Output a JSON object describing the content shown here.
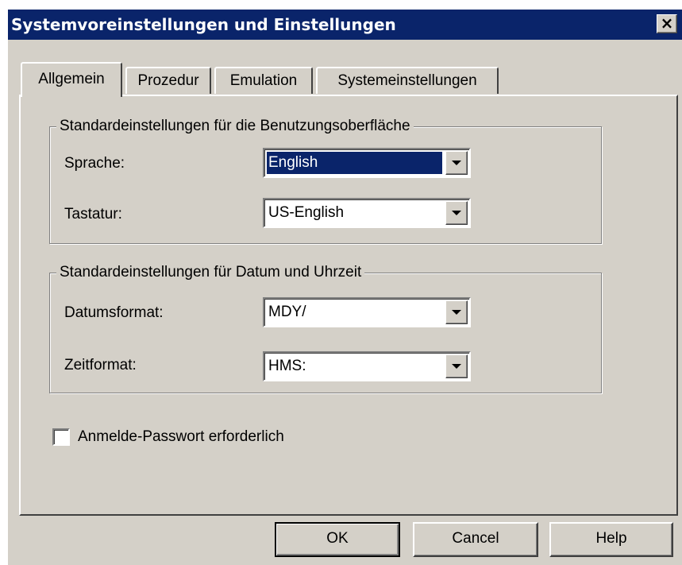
{
  "window": {
    "title": "Systemvoreinstellungen und Einstellungen",
    "close_label": "×"
  },
  "tabs": [
    {
      "label": "Allgemein",
      "active": true
    },
    {
      "label": "Prozedur",
      "active": false
    },
    {
      "label": "Emulation",
      "active": false
    },
    {
      "label": "Systemeinstellungen",
      "active": false
    }
  ],
  "group_ui": {
    "legend": "Standardeinstellungen für die Benutzungsoberfläche",
    "language_label": "Sprache:",
    "language_value": "English",
    "keyboard_label": "Tastatur:",
    "keyboard_value": "US-English"
  },
  "group_datetime": {
    "legend": "Standardeinstellungen für Datum und Uhrzeit",
    "date_label": "Datumsformat:",
    "date_value": "MDY/",
    "time_label": "Zeitformat:",
    "time_value": "HMS:"
  },
  "password_checkbox": {
    "label": "Anmelde-Passwort erforderlich",
    "checked": false
  },
  "buttons": {
    "ok": "OK",
    "cancel": "Cancel",
    "help": "Help"
  },
  "colors": {
    "titlebar": "#0a246a",
    "face": "#d4d0c8",
    "selection": "#0a246a"
  }
}
